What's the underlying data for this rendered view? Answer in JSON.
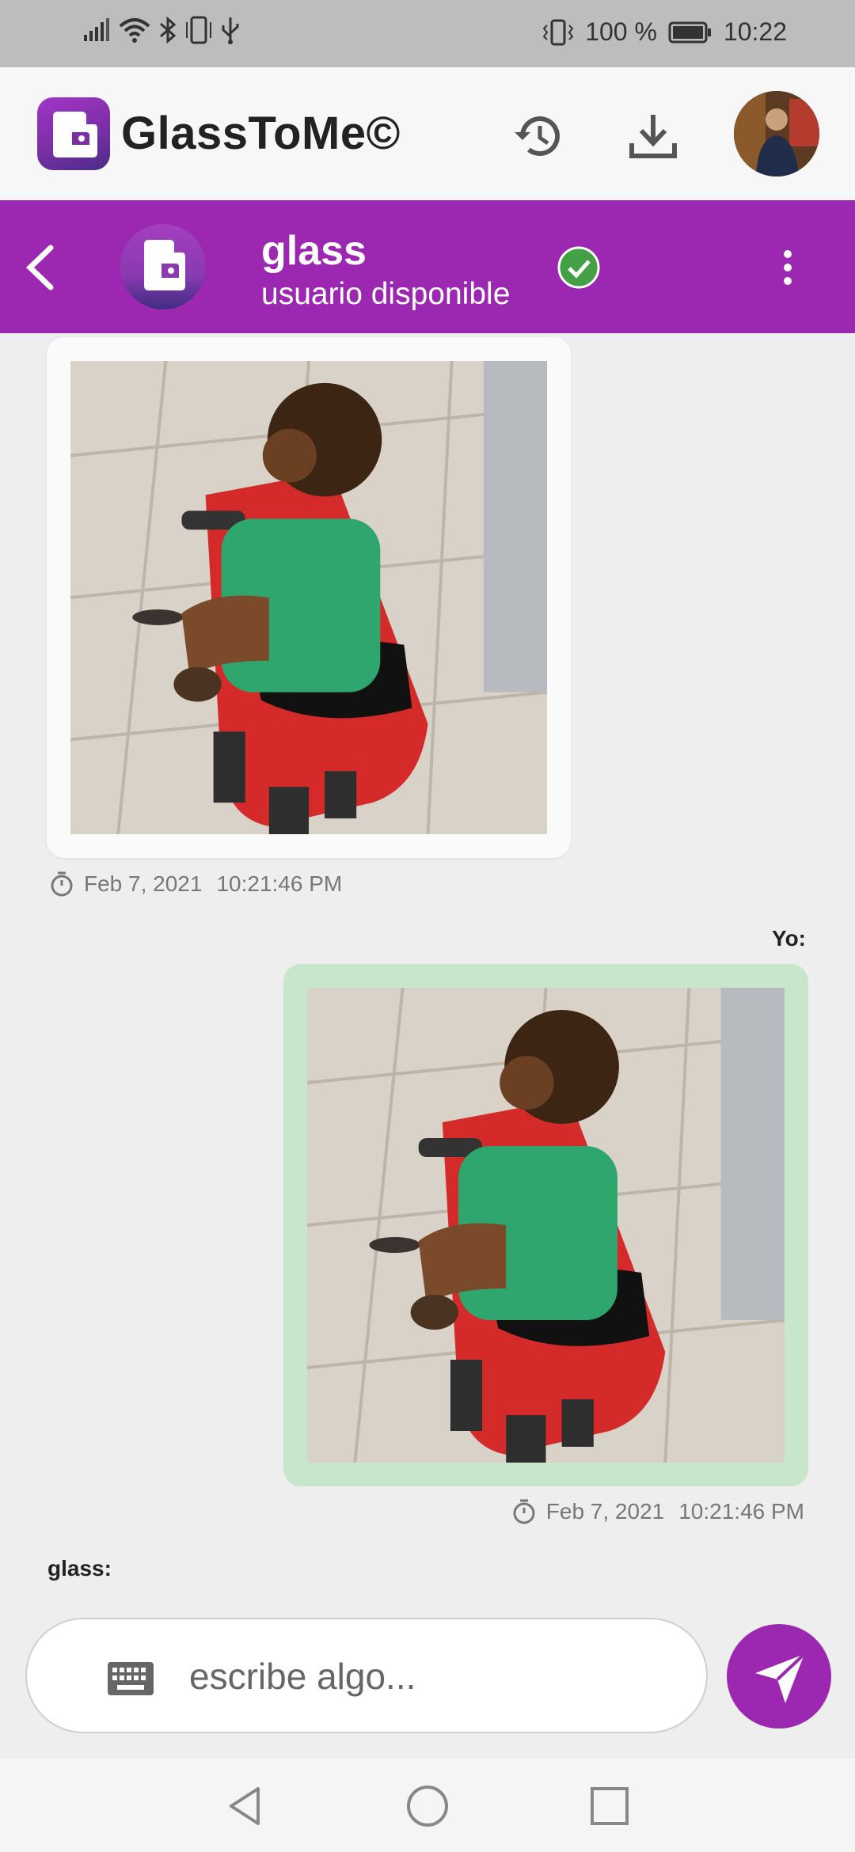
{
  "status_bar": {
    "battery": "100 %",
    "time": "10:22",
    "icons": [
      "signal-icon",
      "wifi-icon",
      "bluetooth-icon",
      "phone-icon",
      "usb-icon",
      "vibrate-icon",
      "battery-icon"
    ]
  },
  "app_bar": {
    "title": "GlassToMe©",
    "icons": [
      "app-logo-icon",
      "history-icon",
      "download-icon"
    ]
  },
  "chat_header": {
    "contact_name": "glass",
    "contact_status": "usuario disponible",
    "icons": [
      "back-arrow-icon",
      "verified-check-icon",
      "more-vert-icon"
    ]
  },
  "messages": [
    {
      "direction": "incoming",
      "type": "image",
      "image_description": "child riding red toy ATV",
      "date": "Feb 7, 2021",
      "time": "10:21:46 PM"
    },
    {
      "direction": "outgoing",
      "sender": "Yo:",
      "type": "image",
      "image_description": "child riding red toy ATV",
      "date": "Feb 7, 2021",
      "time": "10:21:46 PM"
    },
    {
      "direction": "incoming",
      "sender": "glass:"
    }
  ],
  "composer": {
    "placeholder": "escribe algo...",
    "icons": [
      "keyboard-icon",
      "send-icon"
    ]
  },
  "nav_bar": {
    "icons": [
      "nav-back-icon",
      "nav-home-icon",
      "nav-recents-icon"
    ]
  },
  "colors": {
    "accent": "#9c27b0",
    "outgoing_bubble": "#c8e6c9",
    "incoming_bubble": "#fafafa",
    "verified": "#43a047"
  }
}
